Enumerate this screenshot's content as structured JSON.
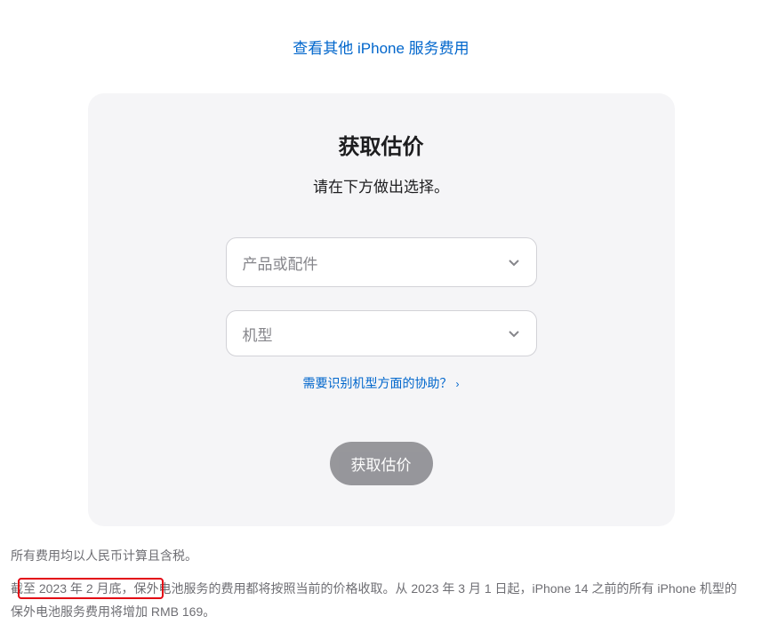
{
  "top_link": "查看其他 iPhone 服务费用",
  "card": {
    "title": "获取估价",
    "subtitle": "请在下方做出选择。",
    "select_product_placeholder": "产品或配件",
    "select_model_placeholder": "机型",
    "help_text": "需要识别机型方面的协助？",
    "submit_label": "获取估价"
  },
  "footer": {
    "line1": "所有费用均以人民币计算且含税。",
    "line2": "截至 2023 年 2 月底，保外电池服务的费用都将按照当前的价格收取。从 2023 年 3 月 1 日起，iPhone 14 之前的所有 iPhone 机型的保外电池服务费用将增加 RMB 169。"
  }
}
